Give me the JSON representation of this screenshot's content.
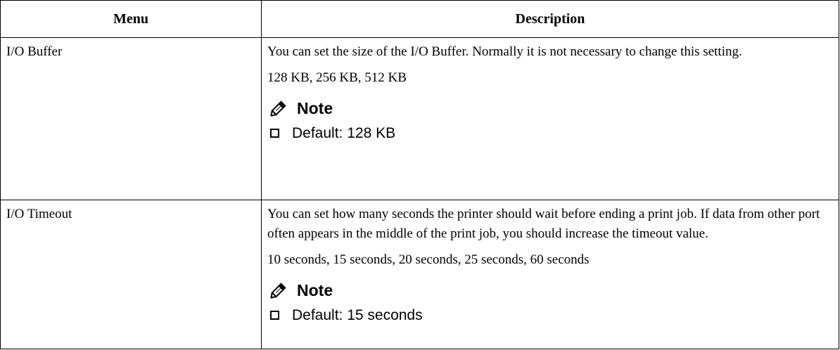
{
  "table": {
    "headers": {
      "menu": "Menu",
      "description": "Description"
    },
    "rows": [
      {
        "menu": "I/O Buffer",
        "description": "You can set the size of the I/O Buffer. Normally it is not necessary to change this setting.",
        "values": "128 KB, 256 KB, 512 KB",
        "note_title": "Note",
        "note_item": "Default: 128 KB"
      },
      {
        "menu": "I/O Timeout",
        "description": "You can set how many seconds the printer should wait before ending a print job. If data from other port often appears in the middle of the print job, you should increase the timeout value.",
        "values": "10 seconds, 15 seconds, 20 seconds, 25 seconds, 60 seconds",
        "note_title": "Note",
        "note_item": "Default: 15 seconds"
      }
    ]
  },
  "icons": {
    "note": "pencil-icon",
    "list_bullet": "checkbox-icon"
  }
}
